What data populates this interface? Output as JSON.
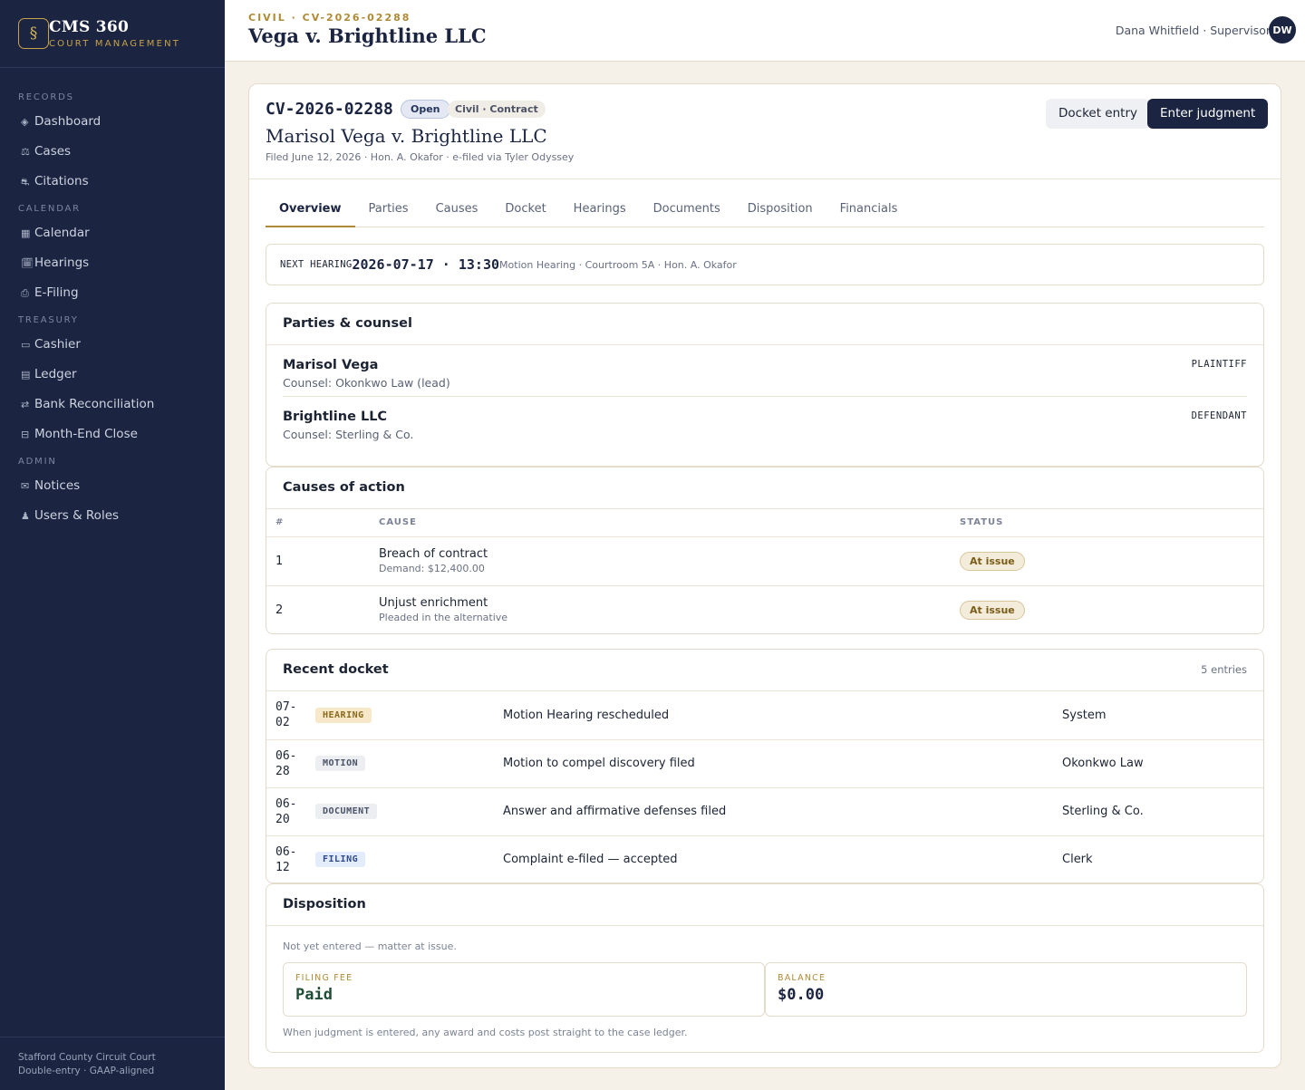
{
  "app": {
    "logo_glyph": "§",
    "name": "CMS 360",
    "subtitle": "COURT MANAGEMENT"
  },
  "sidebar": {
    "sections": [
      {
        "label": "RECORDS",
        "items": [
          {
            "icon": "◈",
            "label": "Dashboard"
          },
          {
            "icon": "⚖",
            "label": "Cases"
          },
          {
            "icon": "⛐",
            "label": "Citations"
          }
        ]
      },
      {
        "label": "CALENDAR",
        "items": [
          {
            "icon": "▦",
            "label": "Calendar"
          },
          {
            "icon": "🗓",
            "label": "Hearings"
          },
          {
            "icon": "⎙",
            "label": "E-Filing"
          }
        ]
      },
      {
        "label": "TREASURY",
        "items": [
          {
            "icon": "▭",
            "label": "Cashier"
          },
          {
            "icon": "▤",
            "label": "Ledger"
          },
          {
            "icon": "⇄",
            "label": "Bank Reconciliation"
          },
          {
            "icon": "⊟",
            "label": "Month-End Close"
          }
        ]
      },
      {
        "label": "ADMIN",
        "items": [
          {
            "icon": "✉",
            "label": "Notices"
          },
          {
            "icon": "♟",
            "label": "Users & Roles"
          }
        ]
      }
    ],
    "footer_line1": "Stafford County Circuit Court",
    "footer_line2": "Double-entry · GAAP-aligned"
  },
  "header": {
    "breadcrumb": "CIVIL · CV-2026-02288",
    "title": "Vega v. Brightline LLC",
    "user_name": "Dana Whitfield · Supervisor",
    "user_initials": "DW"
  },
  "case": {
    "number": "CV-2026-02288",
    "status": "Open",
    "type": "Civil · Contract",
    "parties_title": "Marisol Vega v. Brightline LLC",
    "meta": "Filed June 12, 2026 · Hon. A. Okafor · e-filed via Tyler Odyssey",
    "btn_docket": "Docket entry",
    "btn_judgment": "Enter judgment"
  },
  "tabs": [
    "Overview",
    "Parties",
    "Causes",
    "Docket",
    "Hearings",
    "Documents",
    "Disposition",
    "Financials"
  ],
  "next_hearing": {
    "label": "NEXT HEARING",
    "datetime": "2026-07-17 · 13:30",
    "detail": "Motion Hearing · Courtroom 5A · Hon. A. Okafor"
  },
  "parties": {
    "title": "Parties & counsel",
    "items": [
      {
        "name": "Marisol Vega",
        "counsel": "Counsel: Okonkwo Law (lead)",
        "role": "PLAINTIFF"
      },
      {
        "name": "Brightline LLC",
        "counsel": "Counsel: Sterling & Co.",
        "role": "DEFENDANT"
      }
    ]
  },
  "causes": {
    "title": "Causes of action",
    "headers": [
      "#",
      "CAUSE",
      "STATUS"
    ],
    "rows": [
      {
        "num": "1",
        "cause": "Breach of contract",
        "sub": "Demand: $12,400.00",
        "status": "At issue"
      },
      {
        "num": "2",
        "cause": "Unjust enrichment",
        "sub": "Pleaded in the alternative",
        "status": "At issue"
      }
    ]
  },
  "docket": {
    "title": "Recent docket",
    "count": "5 entries",
    "rows": [
      {
        "date1": "07-",
        "date2": "02",
        "tag": "HEARING",
        "entry": "Motion Hearing rescheduled",
        "by": "System"
      },
      {
        "date1": "06-",
        "date2": "28",
        "tag": "MOTION",
        "entry": "Motion to compel discovery filed",
        "by": "Okonkwo Law"
      },
      {
        "date1": "06-",
        "date2": "20",
        "tag": "DOCUMENT",
        "entry": "Answer and affirmative defenses filed",
        "by": "Sterling & Co."
      },
      {
        "date1": "06-",
        "date2": "12",
        "tag": "FILING",
        "entry": "Complaint e-filed — accepted",
        "by": "Clerk"
      }
    ]
  },
  "disposition": {
    "title": "Disposition",
    "note": "Not yet entered — matter at issue.",
    "filing_fee_label": "FILING FEE",
    "filing_fee_value": "Paid",
    "balance_label": "BALANCE",
    "balance_value": "$0.00",
    "footnote": "When judgment is entered, any award and costs post straight to the case ledger."
  }
}
